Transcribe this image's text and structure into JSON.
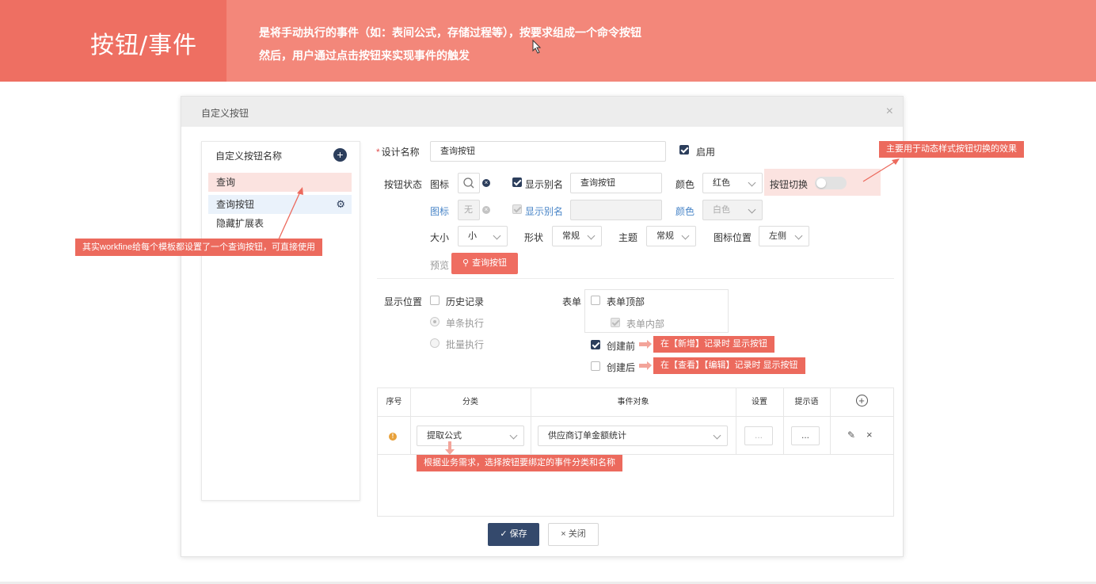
{
  "banner": {
    "title": "按钮/事件",
    "line1": "是将手动执行的事件（如：表间公式，存储过程等），按要求组成一个命令按钮",
    "line2": "然后，用户通过点击按钮来实现事件的触发"
  },
  "dialog": {
    "title": "自定义按钮",
    "close": "×"
  },
  "left_panel": {
    "title": "自定义按钮名称",
    "add": "+",
    "items": [
      {
        "label": "查询"
      },
      {
        "label": "查询按钮"
      },
      {
        "label": "隐藏扩展表"
      }
    ]
  },
  "form": {
    "design_name_label": "设计名称",
    "required_mark": "*",
    "design_name_value": "查询按钮",
    "enable_label": "启用",
    "button_state_label": "按钮状态",
    "icon_label": "图标",
    "show_alias_label": "显示别名",
    "alias_value": "查询按钮",
    "color_label": "颜色",
    "color_value": "红色",
    "toggle_label": "按钮切换",
    "icon_label_2": "图标",
    "icon_value_2": "无",
    "show_alias_label_2": "显示别名",
    "color_label_2": "颜色",
    "color_value_2": "白色",
    "size_label": "大小",
    "size_value": "小",
    "shape_label": "形状",
    "shape_value": "常规",
    "theme_label": "主题",
    "theme_value": "常规",
    "icon_pos_label": "图标位置",
    "icon_pos_value": "左侧",
    "preview_label": "预览",
    "preview_button": "查询按钮",
    "display_pos_label": "显示位置",
    "history_label": "历史记录",
    "single_exec": "单条执行",
    "batch_exec": "批量执行",
    "form_label": "表单",
    "form_top": "表单顶部",
    "form_inside": "表单内部",
    "before_create": "创建前",
    "after_create": "创建后"
  },
  "table": {
    "headers": [
      "序号",
      "分类",
      "事件对象",
      "设置",
      "提示语"
    ],
    "add_icon": "+",
    "row": {
      "index_icon": "!",
      "category": "提取公式",
      "event_object": "供应商订单金额统计",
      "settings": "...",
      "tip": "..."
    }
  },
  "callouts": {
    "toggle_note": "主要用于动态样式按钮切换的效果",
    "left_note": "其实workfine给每个模板都设置了一个查询按钮，可直接使用",
    "before_note": "在【新增】记录时 显示按钮",
    "after_note": "在【查看】【编辑】记录时 显示按钮",
    "category_note": "根据业务需求，选择按钮要绑定的事件分类和名称"
  },
  "footer": {
    "save": "保存",
    "close": "关闭"
  },
  "colors": {
    "banner": "#f3877a",
    "banner_title_bg": "#ee6f62",
    "primary": "#2c3e5c",
    "accent": "#ef6d61"
  }
}
